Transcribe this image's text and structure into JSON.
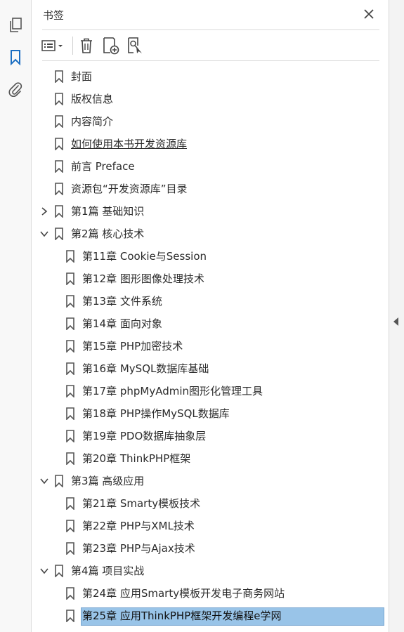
{
  "panel": {
    "title": "书签"
  },
  "rail": {
    "items": [
      {
        "icon": "pages-icon"
      },
      {
        "icon": "bookmark-icon",
        "active": true
      },
      {
        "icon": "paperclip-icon"
      }
    ]
  },
  "colors": {
    "accent": "#1b6ec2",
    "selection": "#99c4e8"
  },
  "bookmarks": [
    {
      "label": "封面",
      "level": 0,
      "expander": "none"
    },
    {
      "label": "版权信息",
      "level": 0,
      "expander": "none"
    },
    {
      "label": "内容简介",
      "level": 0,
      "expander": "none"
    },
    {
      "label": "如何使用本书开发资源库",
      "level": 0,
      "expander": "none",
      "underline": true
    },
    {
      "label": "前言 Preface",
      "level": 0,
      "expander": "none"
    },
    {
      "label": "资源包“开发资源库”目录",
      "level": 0,
      "expander": "none"
    },
    {
      "label": "第1篇 基础知识",
      "level": 0,
      "expander": "collapsed"
    },
    {
      "label": "第2篇 核心技术",
      "level": 0,
      "expander": "expanded"
    },
    {
      "label": "第11章 Cookie与Session",
      "level": 1,
      "expander": "none"
    },
    {
      "label": "第12章 图形图像处理技术",
      "level": 1,
      "expander": "none"
    },
    {
      "label": "第13章 文件系统",
      "level": 1,
      "expander": "none"
    },
    {
      "label": "第14章 面向对象",
      "level": 1,
      "expander": "none"
    },
    {
      "label": "第15章 PHP加密技术",
      "level": 1,
      "expander": "none"
    },
    {
      "label": "第16章 MySQL数据库基础",
      "level": 1,
      "expander": "none"
    },
    {
      "label": "第17章 phpMyAdmin图形化管理工具",
      "level": 1,
      "expander": "none"
    },
    {
      "label": "第18章 PHP操作MySQL数据库",
      "level": 1,
      "expander": "none"
    },
    {
      "label": "第19章 PDO数据库抽象层",
      "level": 1,
      "expander": "none"
    },
    {
      "label": "第20章 ThinkPHP框架",
      "level": 1,
      "expander": "none"
    },
    {
      "label": "第3篇 高级应用",
      "level": 0,
      "expander": "expanded"
    },
    {
      "label": "第21章 Smarty模板技术",
      "level": 1,
      "expander": "none"
    },
    {
      "label": "第22章 PHP与XML技术",
      "level": 1,
      "expander": "none"
    },
    {
      "label": "第23章 PHP与Ajax技术",
      "level": 1,
      "expander": "none"
    },
    {
      "label": "第4篇 项目实战",
      "level": 0,
      "expander": "expanded"
    },
    {
      "label": "第24章 应用Smarty模板开发电子商务网站",
      "level": 1,
      "expander": "none"
    },
    {
      "label": "第25章 应用ThinkPHP框架开发编程e学网",
      "level": 1,
      "expander": "none",
      "selected": true
    }
  ]
}
